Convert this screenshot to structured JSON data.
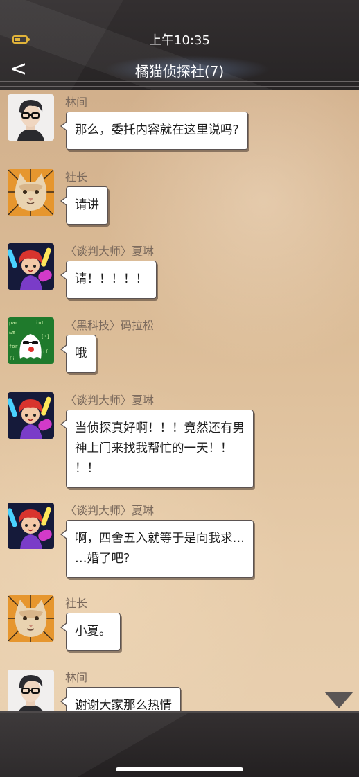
{
  "status_bar": {
    "time": "上午10:35"
  },
  "header": {
    "back_label": "<",
    "title": "橘猫侦探社(7)"
  },
  "messages": [
    {
      "sender": "林间",
      "avatar": "man-glasses-avatar",
      "text": "那么，委托内容就在这里说吗?"
    },
    {
      "sender": "社长",
      "avatar": "cat-avatar",
      "text": "请讲"
    },
    {
      "sender": "〈谈判大师〉夏琳",
      "avatar": "girl-red-hat-avatar",
      "text": "请！！！！！"
    },
    {
      "sender": "〈黑科技〉码拉松",
      "avatar": "ghost-sunglasses-avatar",
      "text": "哦"
    },
    {
      "sender": "〈谈判大师〉夏琳",
      "avatar": "girl-red-hat-avatar",
      "text": "当侦探真好啊！！！竟然还有男\n神上门来找我帮忙的一天！！\n！！"
    },
    {
      "sender": "〈谈判大师〉夏琳",
      "avatar": "girl-red-hat-avatar",
      "text": "啊，四舍五入就等于是向我求…\n…婚了吧?"
    },
    {
      "sender": "社长",
      "avatar": "cat-avatar",
      "text": "小夏。"
    },
    {
      "sender": "林间",
      "avatar": "man-glasses-avatar",
      "text": "谢谢大家那么热情"
    }
  ],
  "colors": {
    "accent_battery": "#e0b33a",
    "bubble_border": "#5b5352",
    "sender_text": "#7b6a5d"
  }
}
